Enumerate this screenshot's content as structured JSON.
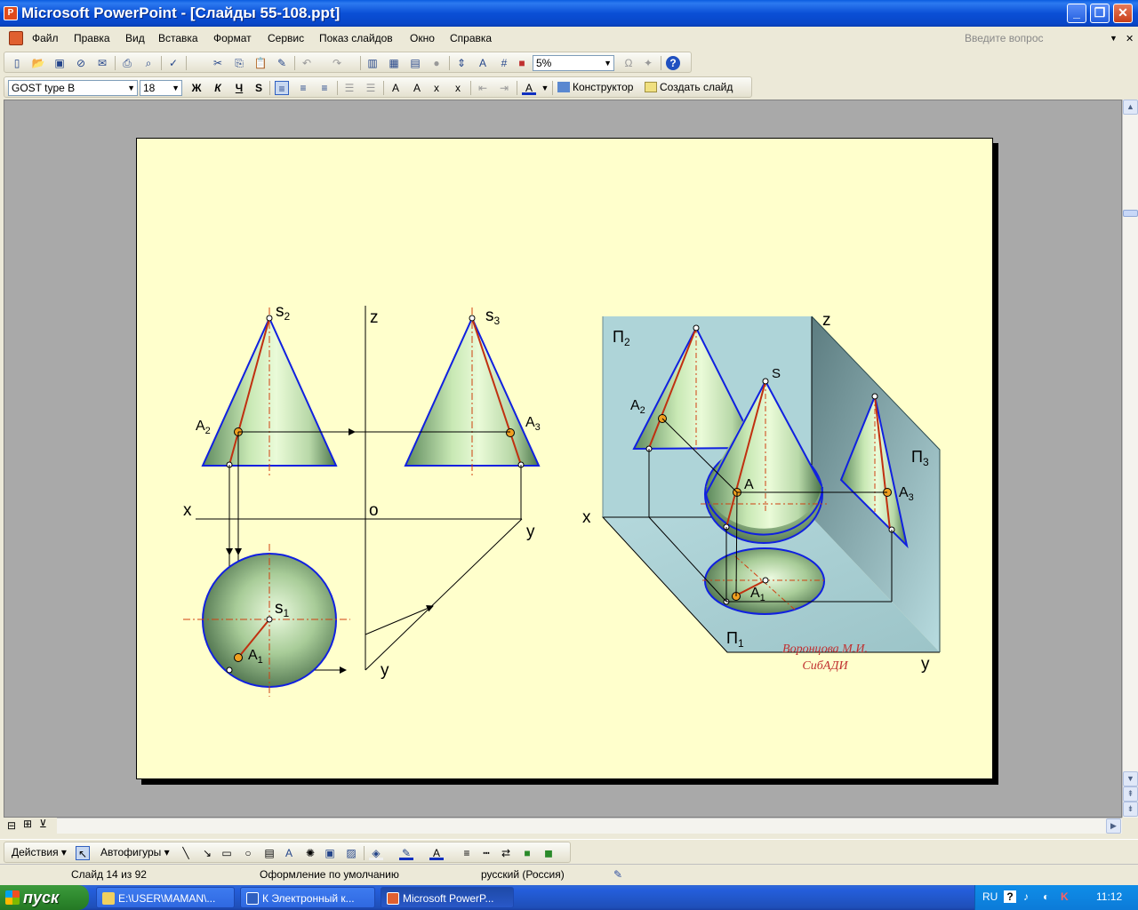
{
  "window": {
    "title": "Microsoft PowerPoint - [Слайды 55-108.ppt]",
    "app_icon": "powerpoint-icon",
    "controls": [
      "minimize",
      "restore",
      "close"
    ]
  },
  "menu": {
    "items": [
      "Файл",
      "Правка",
      "Вид",
      "Вставка",
      "Формат",
      "Сервис",
      "Показ слайдов",
      "Окно",
      "Справка"
    ],
    "help_placeholder": "Введите вопрос"
  },
  "standard_toolbar": {
    "zoom": "5%"
  },
  "format_toolbar": {
    "font": "GOST type B",
    "size": "18",
    "bold": "Ж",
    "italic": "К",
    "underline": "Ч",
    "shadow": "S",
    "designer": "Конструктор",
    "new_slide": "Создать слайд"
  },
  "slide": {
    "background": "#ffffcc",
    "labels": {
      "s2": "s",
      "s2_sub": "2",
      "s3": "s",
      "s3_sub": "3",
      "s1": "s",
      "s1_sub": "1",
      "z": "z",
      "x": "x",
      "o": "o",
      "y_right": "y",
      "y_bottom": "y",
      "a2": "A",
      "a2_sub": "2",
      "a3": "A",
      "a3_sub": "3",
      "a1": "A",
      "a1_sub": "1",
      "p2": "П",
      "p2_sub": "2",
      "p3": "П",
      "p3_sub": "3",
      "p1": "П",
      "p1_sub": "1",
      "iso_z": "z",
      "iso_x": "x",
      "iso_y": "y",
      "iso_s": "S",
      "iso_a": "A",
      "iso_a2": "A",
      "iso_a2_sub": "2",
      "iso_a3": "A",
      "iso_a3_sub": "3",
      "iso_a1": "A",
      "iso_a1_sub": "1",
      "author": "Воронцова М.И.",
      "org": "СибАДИ"
    },
    "colors": {
      "outline": "#1020e0",
      "generatrix": "#c03010",
      "point_fill": "#f0a020",
      "axis_dash": "#d04010",
      "cone_light": "#e6f8d0",
      "cone_dark": "#6a9a6a",
      "plane": "#b8dce0",
      "plane_dark": "#6a8a90",
      "author_text": "#c03030"
    }
  },
  "drawing_toolbar": {
    "actions": "Действия",
    "autoshapes": "Автофигуры"
  },
  "status": {
    "slide": "Слайд 14 из 92",
    "design": "Оформление по умолчанию",
    "language": "русский (Россия)"
  },
  "taskbar": {
    "start": "пуск",
    "tasks": [
      "E:\\USER\\MAMAN\\...",
      "К Электронный к...",
      "Microsoft PowerP..."
    ],
    "lang": "RU",
    "clock": "11:12"
  }
}
